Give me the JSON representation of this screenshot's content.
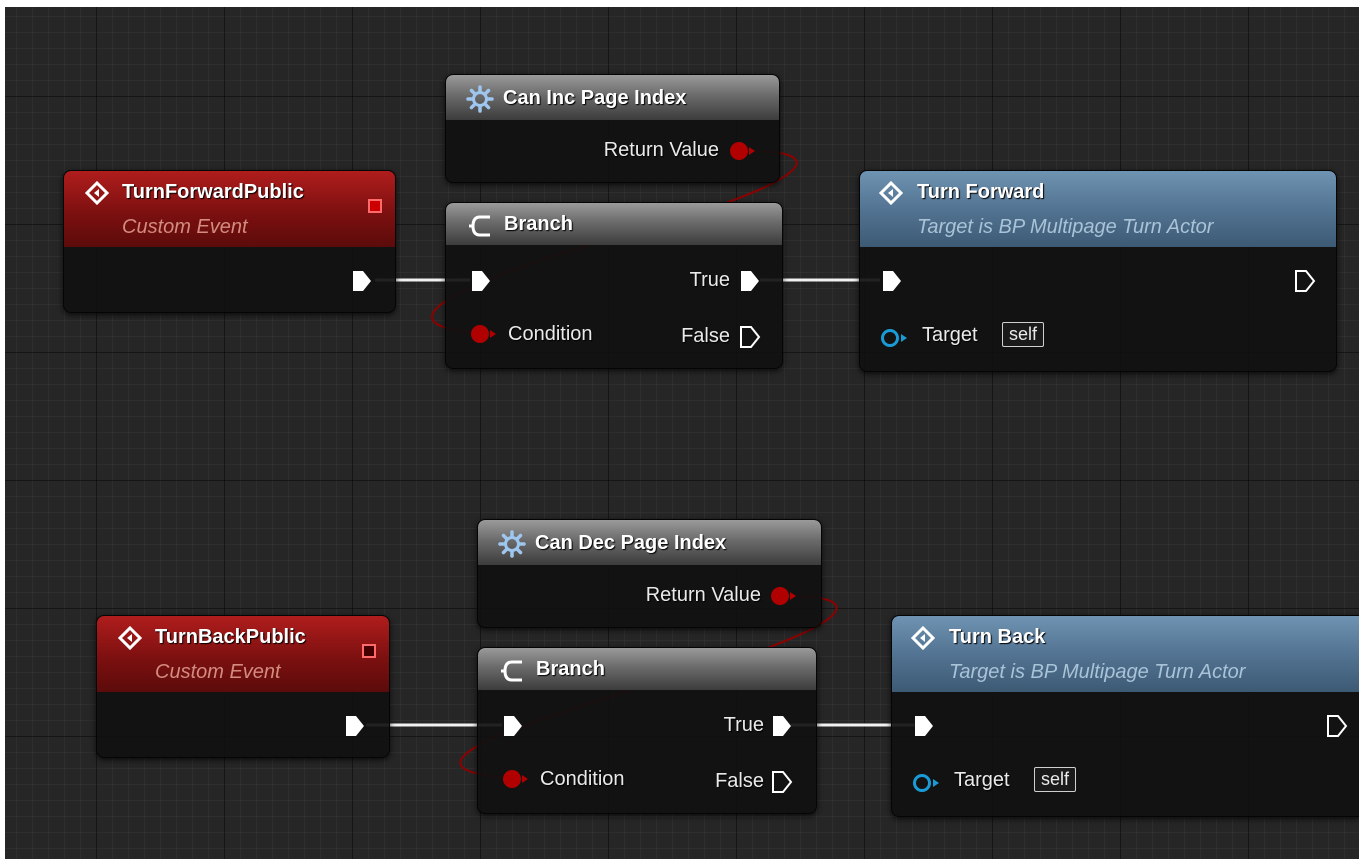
{
  "graph": {
    "top": {
      "event": {
        "title": "TurnForwardPublic",
        "subtitle": "Custom Event"
      },
      "pure": {
        "title": "Can Inc Page Index",
        "return_label": "Return Value"
      },
      "branch": {
        "title": "Branch",
        "true_label": "True",
        "false_label": "False",
        "condition_label": "Condition"
      },
      "call": {
        "title": "Turn Forward",
        "subtitle": "Target is BP Multipage Turn Actor",
        "target_label": "Target",
        "self_label": "self"
      }
    },
    "bottom": {
      "event": {
        "title": "TurnBackPublic",
        "subtitle": "Custom Event"
      },
      "pure": {
        "title": "Can Dec Page Index",
        "return_label": "Return Value"
      },
      "branch": {
        "title": "Branch",
        "true_label": "True",
        "false_label": "False",
        "condition_label": "Condition"
      },
      "call": {
        "title": "Turn Back",
        "subtitle": "Target is BP Multipage Turn Actor",
        "target_label": "Target",
        "self_label": "self"
      }
    }
  },
  "colors": {
    "bool_pin": "#b00000",
    "exec_pin": "#ffffff",
    "object_pin": "#1a9bd6",
    "event_header": "#8a1414",
    "function_header": "#5a7a98",
    "pure_header": "#6b6b6b"
  },
  "icons": {
    "event": "event-diamond-icon",
    "pure_function": "gear-function-icon",
    "branch": "branch-icon",
    "call_function": "function-diamond-icon"
  }
}
